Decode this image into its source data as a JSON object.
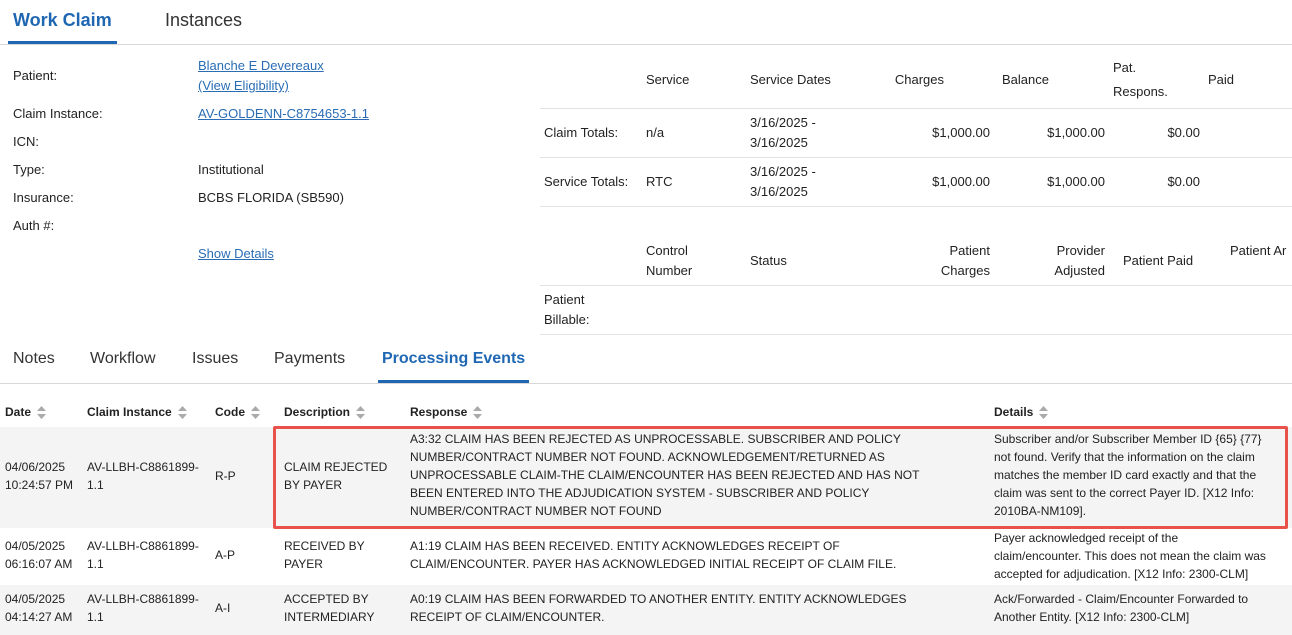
{
  "top_tabs": [
    "Work Claim",
    "Instances"
  ],
  "claim_info": {
    "patient_label": "Patient:",
    "patient_name": "Blanche E Devereaux",
    "view_eligibility": "(View Eligibility)",
    "claim_instance_label": "Claim Instance:",
    "claim_instance": "AV-GOLDENN-C8754653-1.1",
    "icn_label": "ICN:",
    "type_label": "Type:",
    "type": "Institutional",
    "insurance_label": "Insurance:",
    "insurance": "BCBS FLORIDA (SB590)",
    "auth_label": "Auth #:",
    "show_details": "Show Details"
  },
  "summary": {
    "headers": {
      "service": "Service",
      "service_dates": "Service Dates",
      "charges": "Charges",
      "balance": "Balance",
      "pat_respons_1": "Pat.",
      "pat_respons_2": "Respons.",
      "paid": "Paid"
    },
    "rows": [
      {
        "label": "Claim Totals:",
        "service": "n/a",
        "date1": "3/16/2025 -",
        "date2": "3/16/2025",
        "charges": "$1,000.00",
        "balance": "$1,000.00",
        "pat_respons": "$0.00"
      },
      {
        "label": "Service Totals:",
        "service": "RTC",
        "date1": "3/16/2025 -",
        "date2": "3/16/2025",
        "charges": "$1,000.00",
        "balance": "$1,000.00",
        "pat_respons": "$0.00"
      }
    ],
    "headers2": {
      "control_1": "Control",
      "control_2": "Number",
      "status": "Status",
      "patient_charges_1": "Patient",
      "patient_charges_2": "Charges",
      "provider_adjusted_1": "Provider",
      "provider_adjusted_2": "Adjusted",
      "patient_paid": "Patient Paid",
      "patient_ar": "Patient Ar"
    },
    "billable_1": "Patient",
    "billable_2": "Billable:"
  },
  "sub_tabs": [
    "Notes",
    "Workflow",
    "Issues",
    "Payments",
    "Processing Events"
  ],
  "events": {
    "headers": [
      "Date",
      "Claim Instance",
      "Code",
      "Description",
      "Response",
      "Details"
    ],
    "rows": [
      {
        "date1": "04/06/2025",
        "date2": "10:24:57 PM",
        "instance1": "AV-LLBH-C8861899-",
        "instance2": "1.1",
        "code": "R-P",
        "desc1": "CLAIM REJECTED",
        "desc2": "BY PAYER",
        "response": [
          "A3:32 CLAIM HAS BEEN REJECTED AS UNPROCESSABLE. SUBSCRIBER AND POLICY",
          "NUMBER/CONTRACT NUMBER NOT FOUND. ACKNOWLEDGEMENT/RETURNED AS",
          "UNPROCESSABLE CLAIM-THE CLAIM/ENCOUNTER HAS BEEN REJECTED AND HAS NOT",
          "BEEN ENTERED INTO THE ADJUDICATION SYSTEM - SUBSCRIBER AND POLICY",
          "NUMBER/CONTRACT NUMBER NOT FOUND"
        ],
        "details": [
          "Subscriber and/or Subscriber Member ID {65} {77}",
          "not found. Verify that the information on the claim",
          "matches the member ID card exactly and that the",
          "claim was sent to the correct Payer ID. [X12 Info:",
          "2010BA-NM109]."
        ]
      },
      {
        "date1": "04/05/2025",
        "date2": "06:16:07 AM",
        "instance1": "AV-LLBH-C8861899-",
        "instance2": "1.1",
        "code": "A-P",
        "desc1": "RECEIVED BY",
        "desc2": "PAYER",
        "response": [
          "A1:19 CLAIM HAS BEEN RECEIVED. ENTITY ACKNOWLEDGES RECEIPT OF",
          "CLAIM/ENCOUNTER. PAYER HAS ACKNOWLEDGED INITIAL RECEIPT OF CLAIM FILE."
        ],
        "details": [
          "Payer acknowledged receipt of the",
          "claim/encounter. This does not mean the claim was",
          "accepted for adjudication. [X12 Info: 2300-CLM]"
        ]
      },
      {
        "date1": "04/05/2025",
        "date2": "04:14:27 AM",
        "instance1": "AV-LLBH-C8861899-",
        "instance2": "1.1",
        "code": "A-I",
        "desc1": "ACCEPTED BY",
        "desc2": "INTERMEDIARY",
        "response": [
          "A0:19 CLAIM HAS BEEN FORWARDED TO ANOTHER ENTITY. ENTITY ACKNOWLEDGES",
          "RECEIPT OF CLAIM/ENCOUNTER."
        ],
        "details": [
          "Ack/Forwarded - Claim/Encounter Forwarded to",
          "Another Entity. [X12 Info: 2300-CLM]"
        ]
      }
    ]
  },
  "colors": {
    "accent": "#1f67b3",
    "highlight_border": "#e8524a",
    "row_alt": "#f4f4f4"
  }
}
